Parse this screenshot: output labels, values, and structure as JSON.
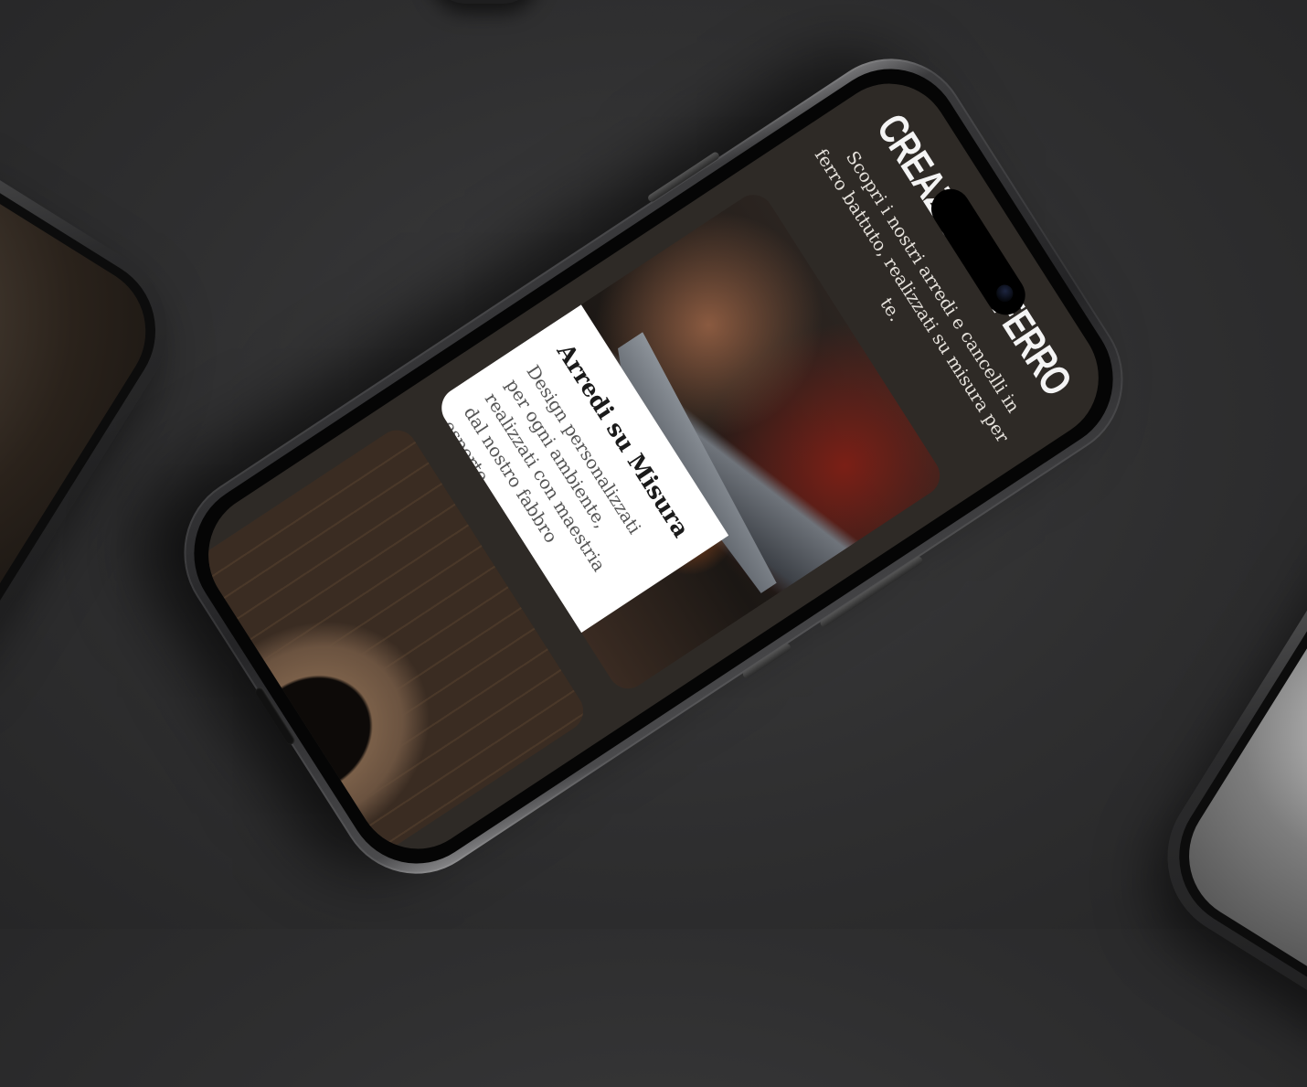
{
  "site": {
    "brand": "CREAZIONI IN FERRO",
    "intro": "Scopri i nostri arredi e cancelli in ferro battuto, realizzati su misura per te.",
    "cards": [
      {
        "title": "Arredi su Misura",
        "text": "Design personalizzati per ogni ambiente, realizzati con maestria dal nostro fabbro esperto."
      }
    ]
  },
  "colors": {
    "background": "#2f2f30",
    "site_background": "#2e2a26",
    "card_body": "#ffffff",
    "brand_text": "#f4f4f4"
  }
}
